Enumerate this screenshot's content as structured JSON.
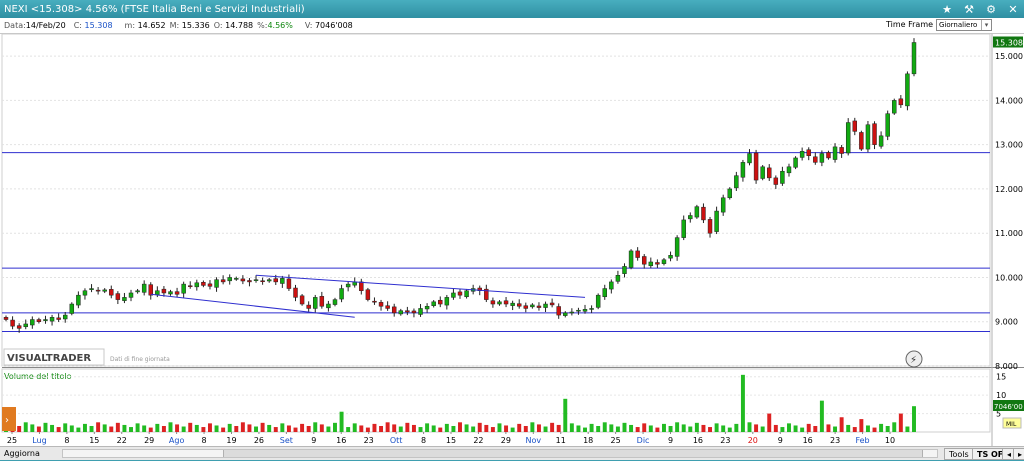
{
  "window": {
    "title": "NEXI <15.308> 4.56%  (FTSE Italia Beni e Servizi Industriali)",
    "star_icon": "star-icon",
    "pin_icon": "pin-icon",
    "settings_icon": "gear-icon",
    "close_icon": "close-icon"
  },
  "infobar": {
    "data_label": "Data:",
    "data_value": "14/Feb/20",
    "close_label": "C:",
    "close_value": "15.308",
    "min_label": "m:",
    "min_value": "14.652",
    "max_label": "M:",
    "max_value": "15.336",
    "open_label": "O:",
    "open_value": "14.788",
    "pct_label": "%:",
    "pct_value": "4.56%",
    "vol_label": "V:",
    "vol_value": "7046'008",
    "timeframe_label": "Time Frame",
    "timeframe_value": "Giornaliero"
  },
  "chart_data": {
    "type": "candlestick",
    "price_axis": {
      "ticks": [
        "15.000",
        "14.000",
        "13.000",
        "12.000",
        "11.000",
        "10.000",
        "9.000",
        "8.000"
      ],
      "range": [
        8.0,
        15.5
      ]
    },
    "last_price_tag": "15.308",
    "horizontal_levels": [
      12.82,
      10.21,
      9.2,
      8.78
    ],
    "watermark": "VISUALTRADER",
    "watermark_sub": "Dati di fine giornata",
    "volume_panel": {
      "label": "Volume del titolo",
      "ticks": [
        "15",
        "10",
        "5"
      ],
      "last_tag": "7046'00",
      "unit": "MIL"
    },
    "x_labels": [
      {
        "text": "25",
        "month": false
      },
      {
        "text": "Lug",
        "month": true
      },
      {
        "text": "8",
        "month": false
      },
      {
        "text": "15",
        "month": false
      },
      {
        "text": "22",
        "month": false
      },
      {
        "text": "29",
        "month": false
      },
      {
        "text": "Ago",
        "month": true
      },
      {
        "text": "8",
        "month": false
      },
      {
        "text": "19",
        "month": false
      },
      {
        "text": "26",
        "month": false
      },
      {
        "text": "Set",
        "month": true
      },
      {
        "text": "9",
        "month": false
      },
      {
        "text": "16",
        "month": false
      },
      {
        "text": "23",
        "month": false
      },
      {
        "text": "Ott",
        "month": true
      },
      {
        "text": "8",
        "month": false
      },
      {
        "text": "15",
        "month": false
      },
      {
        "text": "22",
        "month": false
      },
      {
        "text": "29",
        "month": false
      },
      {
        "text": "Nov",
        "month": true
      },
      {
        "text": "11",
        "month": false
      },
      {
        "text": "18",
        "month": false
      },
      {
        "text": "25",
        "month": false
      },
      {
        "text": "Dic",
        "month": true
      },
      {
        "text": "9",
        "month": false
      },
      {
        "text": "16",
        "month": false
      },
      {
        "text": "23",
        "month": false
      },
      {
        "text": "20",
        "month": true,
        "red": true
      },
      {
        "text": "9",
        "month": false
      },
      {
        "text": "16",
        "month": false
      },
      {
        "text": "23",
        "month": false
      },
      {
        "text": "Feb",
        "month": true
      },
      {
        "text": "10",
        "month": false
      }
    ],
    "closes": [
      9.05,
      8.9,
      8.85,
      8.95,
      9.05,
      9.0,
      9.05,
      9.1,
      9.05,
      9.15,
      9.4,
      9.6,
      9.7,
      9.75,
      9.7,
      9.72,
      9.6,
      9.5,
      9.55,
      9.65,
      9.7,
      9.85,
      9.6,
      9.7,
      9.65,
      9.68,
      9.62,
      9.85,
      9.8,
      9.88,
      9.82,
      9.8,
      9.95,
      9.9,
      10.0,
      9.98,
      9.92,
      9.9,
      9.95,
      9.92,
      9.95,
      9.9,
      9.98,
      9.75,
      9.55,
      9.4,
      9.3,
      9.55,
      9.35,
      9.4,
      9.5,
      9.75,
      9.85,
      9.9,
      9.7,
      9.5,
      9.45,
      9.35,
      9.3,
      9.2,
      9.25,
      9.22,
      9.2,
      9.3,
      9.35,
      9.45,
      9.4,
      9.55,
      9.65,
      9.6,
      9.7,
      9.75,
      9.7,
      9.5,
      9.4,
      9.45,
      9.4,
      9.42,
      9.35,
      9.3,
      9.38,
      9.32,
      9.4,
      9.38,
      9.15,
      9.2,
      9.22,
      9.26,
      9.28,
      9.3,
      9.6,
      9.75,
      9.9,
      10.05,
      10.25,
      10.6,
      10.45,
      10.3,
      10.35,
      10.3,
      10.4,
      10.5,
      10.9,
      11.3,
      11.4,
      11.6,
      11.3,
      11.0,
      11.5,
      11.8,
      12.0,
      12.3,
      12.6,
      12.8,
      12.2,
      12.5,
      12.25,
      12.1,
      12.4,
      12.5,
      12.7,
      12.85,
      12.75,
      12.6,
      12.8,
      12.7,
      12.95,
      12.8,
      13.5,
      13.3,
      12.9,
      13.45,
      13.0,
      13.2,
      13.7,
      14.0,
      13.9,
      14.6,
      15.308
    ]
  },
  "statusbar": {
    "aggiorna": "Aggiorna",
    "tools": "Tools",
    "tsoff": "TS OFF",
    "prev": "◂",
    "next": "▸"
  }
}
